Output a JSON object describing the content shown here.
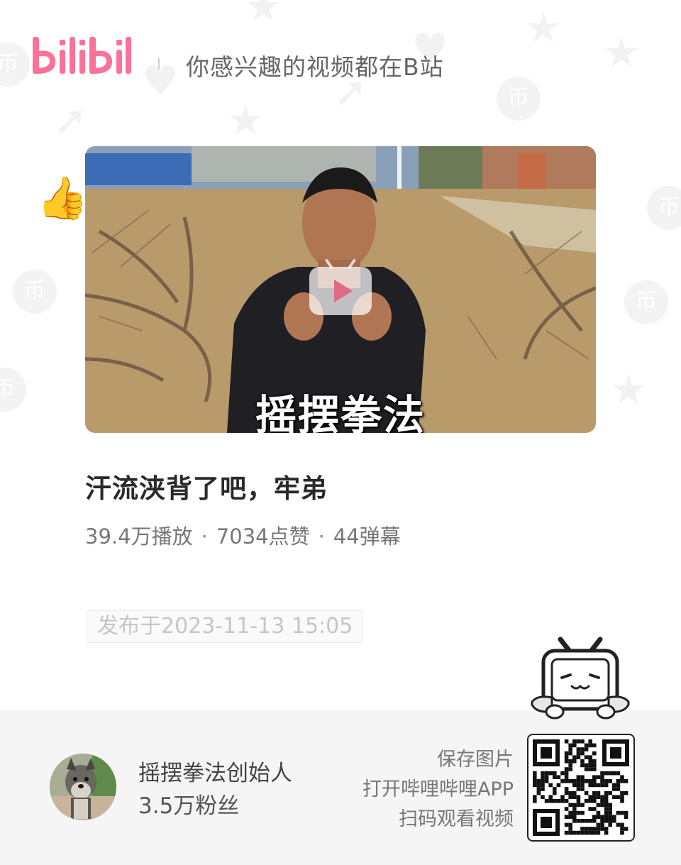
{
  "header": {
    "logo_text": "bilibili",
    "slogan": "你感兴趣的视频都在B站"
  },
  "video": {
    "thumbnail_caption": "摇摆拳法",
    "title": "汗流浃背了吧，牢弟",
    "stats": {
      "plays": "39.4万播放",
      "likes": "7034点赞",
      "danmaku": "44弹幕",
      "separator": "·"
    },
    "published": "发布于2023-11-13 15:05"
  },
  "uploader": {
    "name": "摇摆拳法创始人",
    "fans": "3.5万粉丝"
  },
  "share": {
    "line1": "保存图片",
    "line2": "打开哔哩哔哩APP",
    "line3": "扫码观看视频"
  },
  "colors": {
    "brand_pink": "#fb7299",
    "footer_bg": "#f5f5f5"
  },
  "icons": [
    "play-icon",
    "qr-code",
    "tv-mascot-icon"
  ]
}
